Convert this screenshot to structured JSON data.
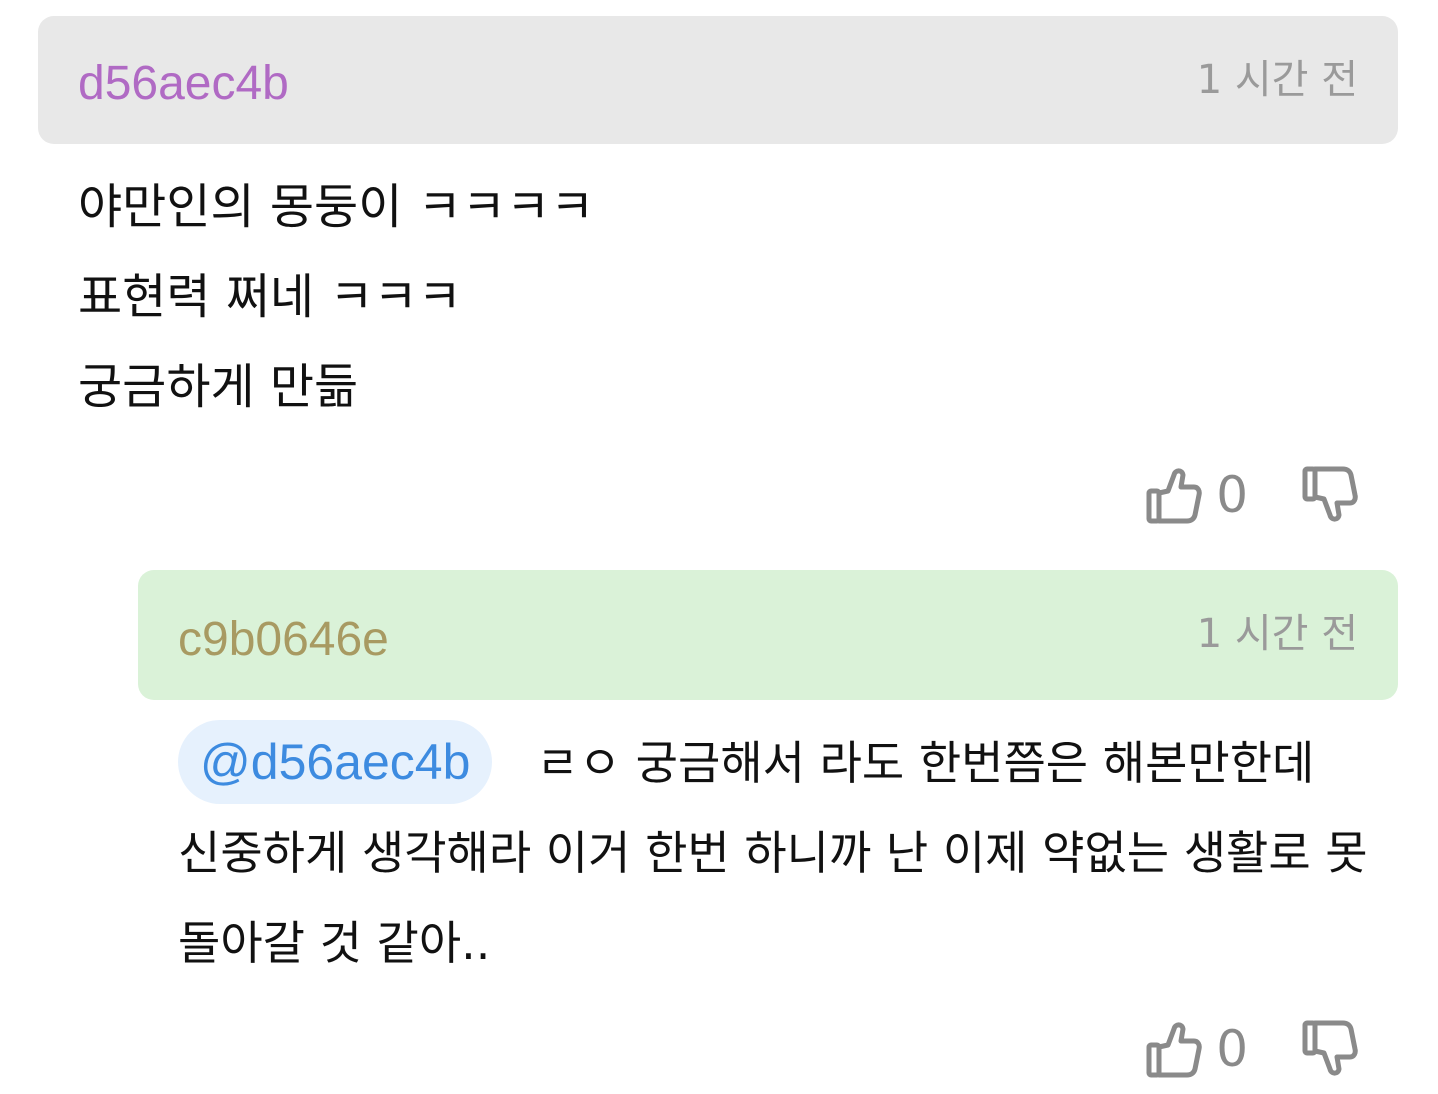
{
  "comments": [
    {
      "username": "d56aec4b",
      "time": "1 시간 전",
      "text": "야만인의 몽둥이 ㅋㅋㅋㅋ\n표현력 쩌네 ㅋㅋㅋ\n궁금하게 만듦",
      "likes": "0",
      "header_color": "#e8e8e8",
      "username_color": "#b06ac4"
    },
    {
      "username": "c9b0646e",
      "time": "1 시간 전",
      "mention": "@d56aec4b",
      "text": "ㄹㅇ 궁금해서 라도 한번쯤은 해본만한데 신중하게 생각해라 이거 한번 하니까 난 이제 약없는 생활로 못 돌아갈 것 같아..",
      "likes": "0",
      "header_color": "#daf2d8",
      "username_color": "#a89a62"
    }
  ],
  "colors": {
    "mention_bg": "#e6f1fd",
    "mention_text": "#3d8be0",
    "timestamp": "#9a9a9a",
    "icon": "#8a8a8a"
  },
  "icons": {
    "like": "thumbs-up-icon",
    "dislike": "thumbs-down-icon"
  }
}
